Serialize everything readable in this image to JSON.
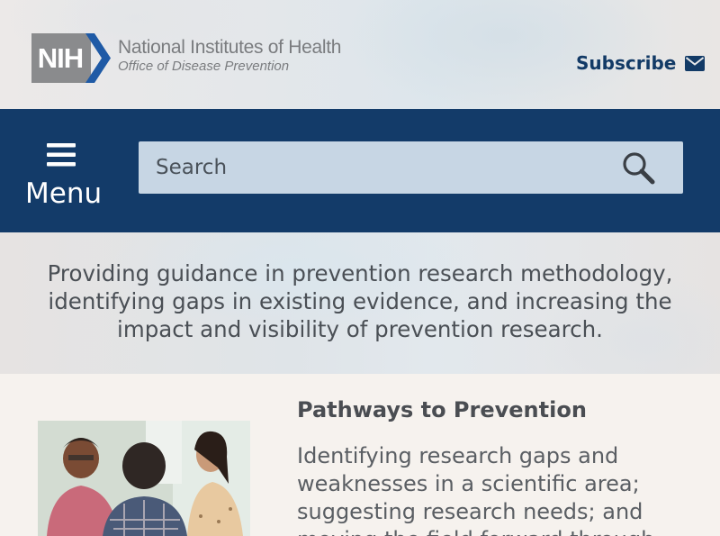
{
  "header": {
    "logo_mark": "NIH",
    "org_name": "National Institutes of Health",
    "office_name": "Office of Disease Prevention",
    "subscribe_label": "Subscribe"
  },
  "nav": {
    "menu_label": "Menu",
    "search_placeholder": "Search"
  },
  "tagline": "Providing guidance in prevention research methodology, identifying gaps in existing evidence, and increasing the impact and visibility of prevention research.",
  "feature": {
    "title": "Pathways to Prevention",
    "text": "Identifying research gaps and weaknesses in a scientific area; suggesting research needs; and moving the field forward through"
  },
  "colors": {
    "brand_navy": "#133b69",
    "search_bg": "#c7d6e4",
    "nih_grey": "#8a8b8d",
    "nih_blue": "#1f5aa6"
  }
}
